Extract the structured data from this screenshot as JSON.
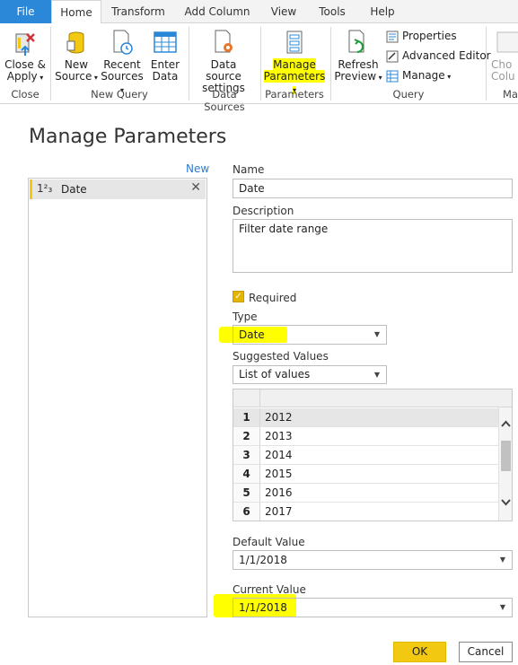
{
  "ribbon": {
    "tabs": [
      {
        "label": "File"
      },
      {
        "label": "Home"
      },
      {
        "label": "Transform"
      },
      {
        "label": "Add Column"
      },
      {
        "label": "View"
      },
      {
        "label": "Tools"
      },
      {
        "label": "Help"
      }
    ],
    "buttons": {
      "close_apply": {
        "line1": "Close &",
        "line2": "Apply"
      },
      "new_source": {
        "line1": "New",
        "line2": "Source"
      },
      "recent_sources": {
        "line1": "Recent",
        "line2": "Sources"
      },
      "enter_data": {
        "line1": "Enter",
        "line2": "Data"
      },
      "data_source_settings": {
        "line1": "Data source",
        "line2": "settings"
      },
      "manage_parameters": {
        "line1": "Manage",
        "line2": "Parameters"
      },
      "refresh_preview": {
        "line1": "Refresh",
        "line2": "Preview"
      },
      "properties": "Properties",
      "advanced_editor": "Advanced Editor",
      "manage": "Manage",
      "choose_columns": {
        "line1": "Cho",
        "line2": "Colu"
      }
    },
    "groups": {
      "close": "Close",
      "new_query": "New Query",
      "data_sources": "Data Sources",
      "parameters": "Parameters",
      "query": "Query",
      "manage_cut": "Ma"
    }
  },
  "dialog": {
    "title": "Manage Parameters",
    "new_link": "New",
    "parameters": [
      {
        "type_icon": "1²₃",
        "name": "Date"
      }
    ],
    "fields": {
      "name_label": "Name",
      "name_value": "Date",
      "description_label": "Description",
      "description_value": "Filter date range",
      "required_label": "Required",
      "required_checked": true,
      "type_label": "Type",
      "type_value": "Date",
      "suggested_label": "Suggested Values",
      "suggested_value": "List of values",
      "default_label": "Default Value",
      "default_value": "1/1/2018",
      "current_label": "Current Value",
      "current_value": "1/1/2018"
    },
    "values_list": [
      {
        "index": "1",
        "value": "2012"
      },
      {
        "index": "2",
        "value": "2013"
      },
      {
        "index": "3",
        "value": "2014"
      },
      {
        "index": "4",
        "value": "2015"
      },
      {
        "index": "5",
        "value": "2016"
      },
      {
        "index": "6",
        "value": "2017"
      }
    ],
    "ok_label": "OK",
    "cancel_label": "Cancel"
  },
  "colors": {
    "accent_yellow": "#f2c811",
    "highlight": "#ffff00",
    "file_tab": "#2b88d8",
    "link_blue": "#2b7cd3"
  }
}
